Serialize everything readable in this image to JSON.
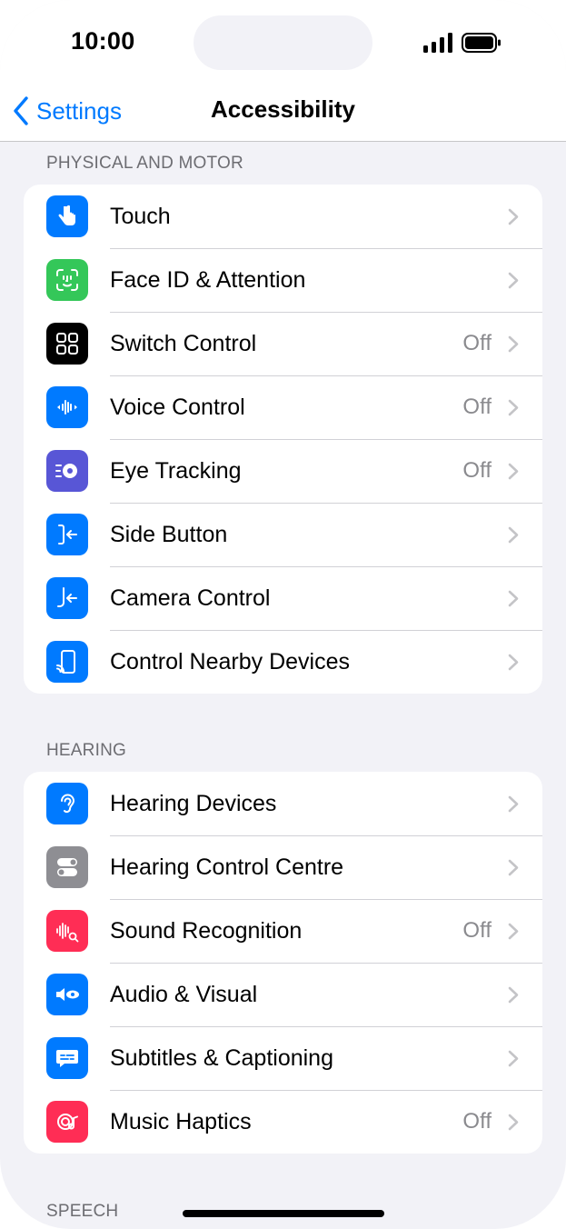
{
  "status": {
    "time": "10:00"
  },
  "nav": {
    "back_label": "Settings",
    "title": "Accessibility"
  },
  "colors": {
    "accent": "#007aff"
  },
  "sections": [
    {
      "header": "PHYSICAL AND MOTOR",
      "items": [
        {
          "label": "Touch",
          "value": "",
          "icon": "hand-point-icon",
          "color": "#007aff"
        },
        {
          "label": "Face ID & Attention",
          "value": "",
          "icon": "face-id-icon",
          "color": "#34c759"
        },
        {
          "label": "Switch Control",
          "value": "Off",
          "icon": "grid-squares-icon",
          "color": "#000000"
        },
        {
          "label": "Voice Control",
          "value": "Off",
          "icon": "waveform-icon",
          "color": "#007aff"
        },
        {
          "label": "Eye Tracking",
          "value": "Off",
          "icon": "eye-tracking-icon",
          "color": "#5856d6"
        },
        {
          "label": "Side Button",
          "value": "",
          "icon": "side-button-icon",
          "color": "#007aff"
        },
        {
          "label": "Camera Control",
          "value": "",
          "icon": "camera-control-icon",
          "color": "#007aff"
        },
        {
          "label": "Control Nearby Devices",
          "value": "",
          "icon": "nearby-devices-icon",
          "color": "#007aff"
        }
      ]
    },
    {
      "header": "HEARING",
      "items": [
        {
          "label": "Hearing Devices",
          "value": "",
          "icon": "ear-icon",
          "color": "#007aff"
        },
        {
          "label": "Hearing Control Centre",
          "value": "",
          "icon": "toggles-icon",
          "color": "#8e8e93"
        },
        {
          "label": "Sound Recognition",
          "value": "Off",
          "icon": "sound-search-icon",
          "color": "#ff2d55"
        },
        {
          "label": "Audio & Visual",
          "value": "",
          "icon": "speaker-eye-icon",
          "color": "#007aff"
        },
        {
          "label": "Subtitles & Captioning",
          "value": "",
          "icon": "caption-bubble-icon",
          "color": "#007aff"
        },
        {
          "label": "Music Haptics",
          "value": "Off",
          "icon": "music-haptics-icon",
          "color": "#ff2d55"
        }
      ]
    },
    {
      "header": "SPEECH",
      "items": []
    }
  ]
}
